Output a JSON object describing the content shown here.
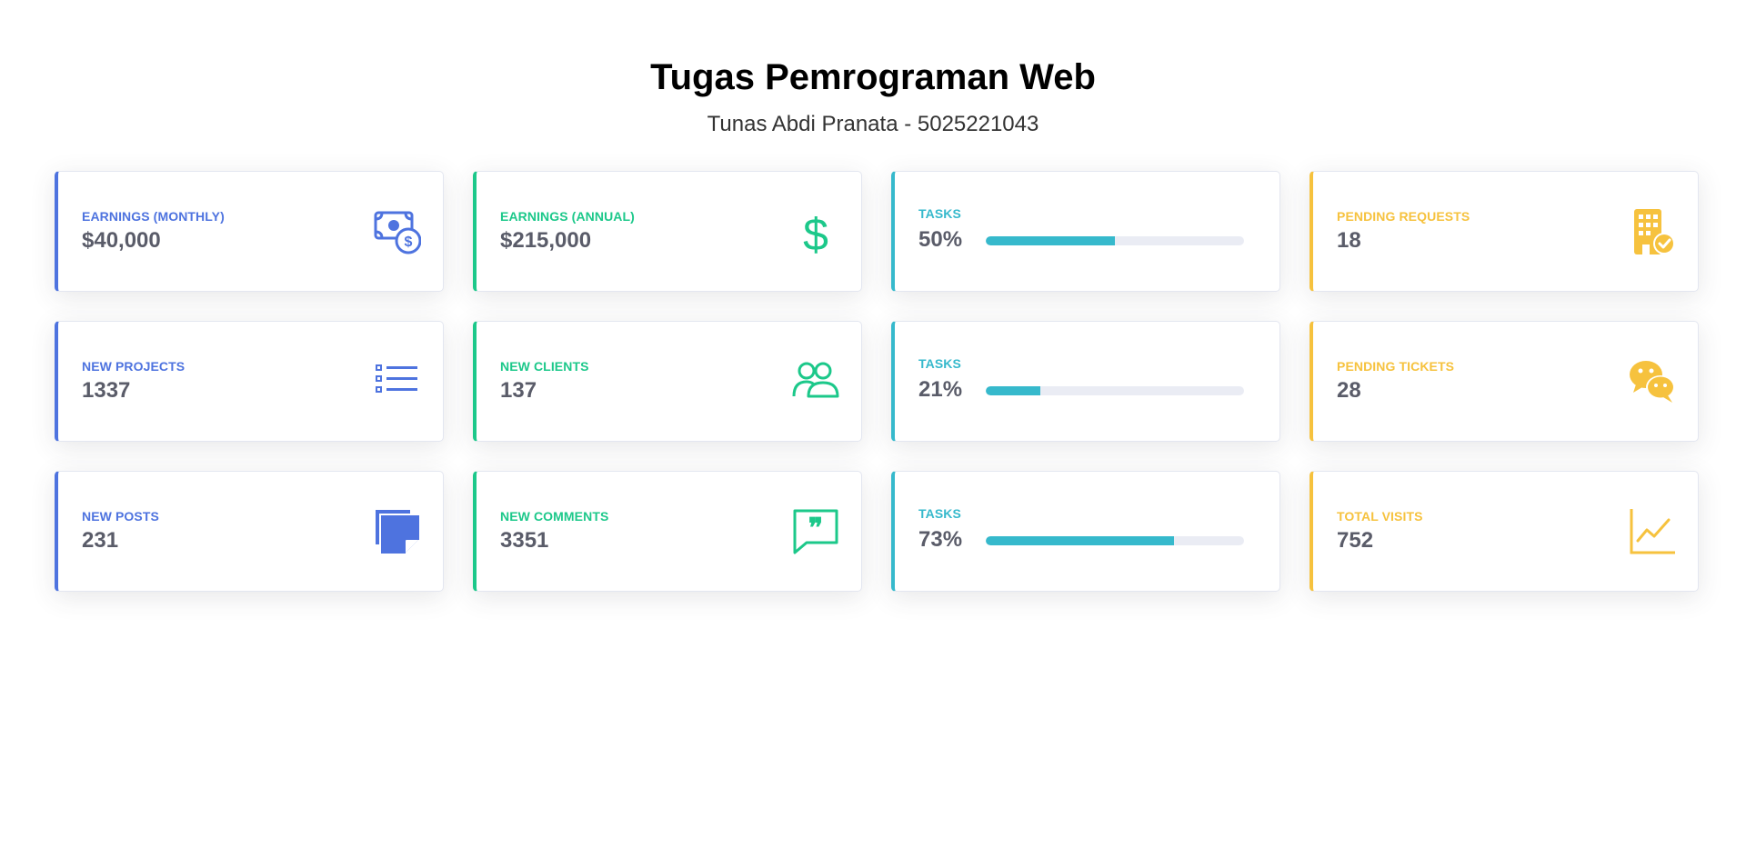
{
  "header": {
    "title": "Tugas Pemrograman Web",
    "subtitle": "Tunas Abdi Pranata - 5025221043"
  },
  "colors": {
    "primary": "#4e73df",
    "success": "#1cc88a",
    "info": "#36b9cc",
    "warning": "#f6c23e",
    "value_text": "#5a5c69"
  },
  "cards": [
    {
      "label": "EARNINGS (MONTHLY)",
      "value": "$40,000",
      "variant": "primary",
      "icon": "money-bill-dollar-icon"
    },
    {
      "label": "EARNINGS (ANNUAL)",
      "value": "$215,000",
      "variant": "success",
      "icon": "dollar-sign-icon"
    },
    {
      "label": "TASKS",
      "value": "50%",
      "variant": "info",
      "progress": 0.5
    },
    {
      "label": "PENDING REQUESTS",
      "value": "18",
      "variant": "warning",
      "icon": "building-check-icon"
    },
    {
      "label": "NEW PROJECTS",
      "value": "1337",
      "variant": "primary",
      "icon": "list-icon"
    },
    {
      "label": "NEW CLIENTS",
      "value": "137",
      "variant": "success",
      "icon": "users-icon"
    },
    {
      "label": "TASKS",
      "value": "21%",
      "variant": "info",
      "progress": 0.21
    },
    {
      "label": "PENDING TICKETS",
      "value": "28",
      "variant": "warning",
      "icon": "wechat-icon"
    },
    {
      "label": "NEW POSTS",
      "value": "231",
      "variant": "primary",
      "icon": "sticky-note-icon"
    },
    {
      "label": "NEW COMMENTS",
      "value": "3351",
      "variant": "success",
      "icon": "comment-quote-icon"
    },
    {
      "label": "TASKS",
      "value": "73%",
      "variant": "info",
      "progress": 0.73
    },
    {
      "label": "TOTAL VISITS",
      "value": "752",
      "variant": "warning",
      "icon": "line-chart-icon"
    }
  ]
}
